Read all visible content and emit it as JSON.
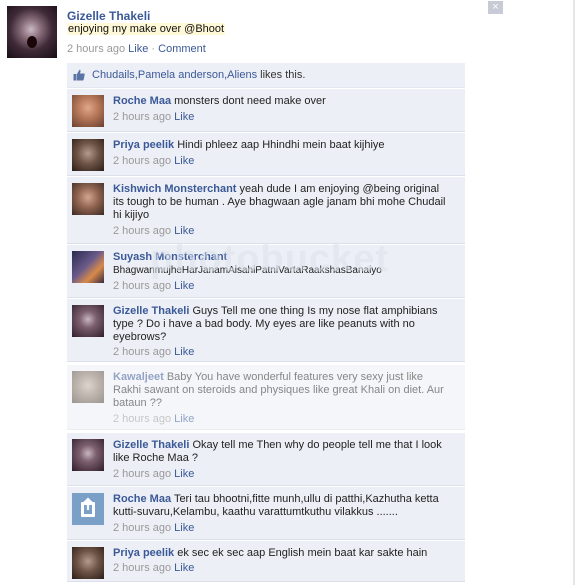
{
  "post": {
    "author": "Gizelle Thakeli",
    "text": "enjoying my make over @Bhoot",
    "time": "2 hours ago",
    "like_label": "Like",
    "comment_label": "Comment",
    "separator": "·"
  },
  "close_icon": "×",
  "likes": {
    "names": "Chudails,Pamela anderson,Aliens",
    "suffix": " likes this."
  },
  "watermark": "photobucket",
  "comments": [
    {
      "author": "Roche Maa",
      "text": "monsters dont need make over",
      "time": "2 hours ago",
      "like": "Like"
    },
    {
      "author": "Priya peelik",
      "text": "Hindi phleez aap Hhindhi mein baat kijhiye",
      "time": "2 hours ago",
      "like": "Like"
    },
    {
      "author": "Kishwich Monsterchant",
      "text": "yeah dude I am enjoying @being original its tough to be human . Aye bhagwaan agle janam bhi mohe Chudail hi kijiyo",
      "time": "2 hours ago",
      "like": "Like"
    },
    {
      "author": "Suyash Monsterchant",
      "text": "BhagwanmujheHarJanamAisahiPatniVartaRaakshasBanaiyo",
      "time": "2 hours ago",
      "like": "Like"
    },
    {
      "author": "Gizelle Thakeli",
      "text": "Guys Tell me one thing Is my nose flat amphibians type ? Do i have a bad body. My eyes are like peanuts with no eyebrows?",
      "time": "2 hours ago",
      "like": "Like"
    },
    {
      "author": "Kawaljeet",
      "text": "Baby You have wonderful features very sexy just like Rakhi sawant on steroids and physiques like great Khali on diet. Aur bataun ??",
      "time": "2 hours ago",
      "like": "Like"
    },
    {
      "author": "Gizelle Thakeli",
      "text": "Okay tell me Then why do people tell me that I look like Roche Maa ?",
      "time": "2 hours ago",
      "like": "Like"
    },
    {
      "author": "Roche Maa",
      "text": "Teri tau bhootni,fitte munh,ullu di patthi,Kazhutha ketta kutti-suvaru,Kelambu, kaathu varattumtkuthu vilakkus .......",
      "time": "2 hours ago",
      "like": "Like"
    },
    {
      "author": "Priya peelik",
      "text": "ek sec ek sec aap English mein baat kar sakte hain",
      "time": "2 hours ago",
      "like": "Like"
    }
  ]
}
